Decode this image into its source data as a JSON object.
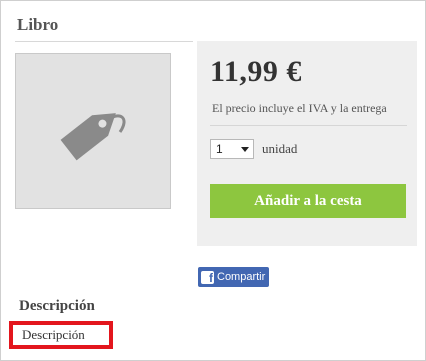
{
  "product": {
    "title": "Libro",
    "price": "11,99 €",
    "price_note": "El precio incluye el IVA y la entrega",
    "quantity": {
      "selected": "1",
      "unit_label": "unidad"
    },
    "add_to_cart_label": "Añadir a la cesta",
    "image_icon": "price-tag-icon"
  },
  "share": {
    "icon": "facebook-icon",
    "icon_glyph": "f",
    "label": "Compartir"
  },
  "description": {
    "heading": "Descripción",
    "content": "Descripción"
  },
  "colors": {
    "accent_button": "#8dc63f",
    "facebook": "#4267b2",
    "highlight_border": "#e3161d"
  }
}
